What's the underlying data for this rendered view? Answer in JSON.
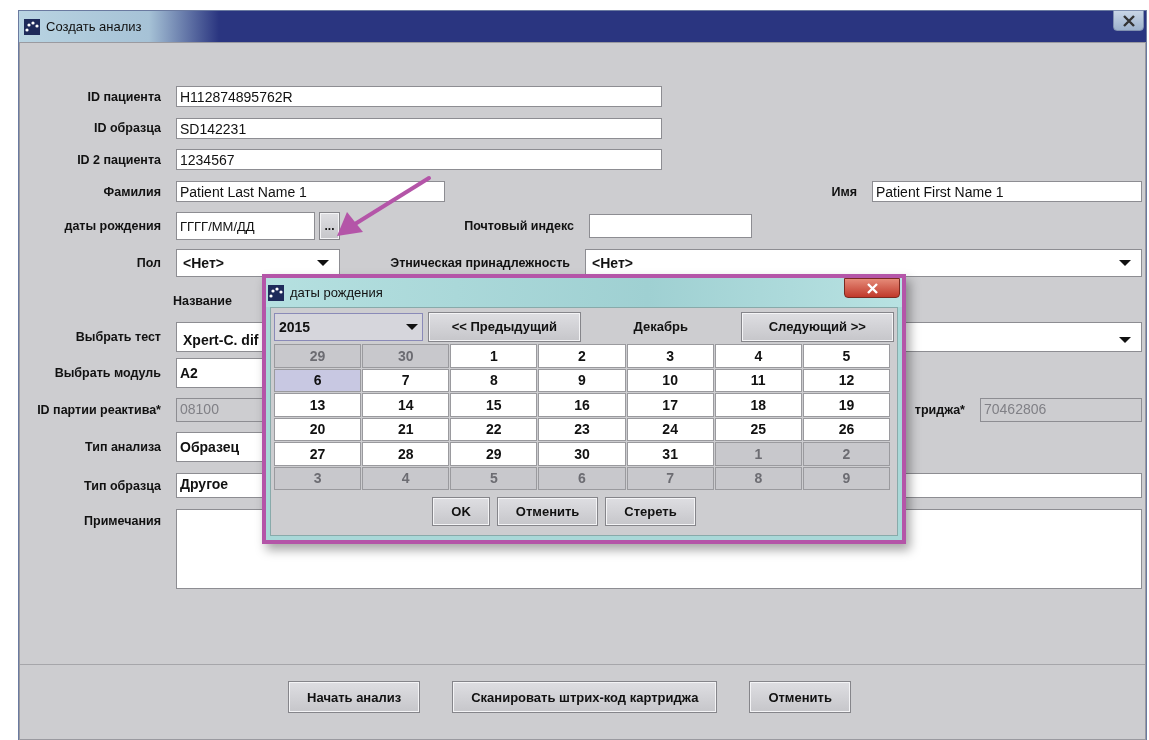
{
  "window": {
    "title": "Создать анализ"
  },
  "form": {
    "rows": [
      {
        "items": [
          {
            "kind": "label",
            "text": "ID пациента"
          },
          {
            "kind": "text",
            "value": "H112874895762R",
            "disabled": false
          }
        ]
      },
      {
        "items": [
          {
            "kind": "label",
            "text": "ID образца"
          },
          {
            "kind": "text",
            "value": "SD142231",
            "disabled": false
          }
        ]
      },
      {
        "items": [
          {
            "kind": "label",
            "text": "ID 2 пациента"
          },
          {
            "kind": "text",
            "value": "1234567",
            "disabled": false
          }
        ]
      },
      {
        "items": [
          {
            "kind": "label",
            "text": "Фамилия"
          },
          {
            "kind": "text",
            "value": "Patient Last Name 1",
            "disabled": false
          },
          {
            "kind": "label",
            "text": "Имя"
          },
          {
            "kind": "text",
            "value": "Patient First Name 1",
            "disabled": false
          }
        ]
      },
      {
        "items": [
          {
            "kind": "label",
            "text": "даты рождения"
          },
          {
            "kind": "text",
            "value": "ГГГГ/ММ/ДД",
            "disabled": false
          },
          {
            "kind": "button",
            "text": "..."
          },
          {
            "kind": "label",
            "text": "Почтовый индекс"
          },
          {
            "kind": "text",
            "disabled": false
          }
        ]
      },
      {
        "items": [
          {
            "kind": "label",
            "text": "Пол"
          },
          {
            "kind": "combo",
            "value": "<Нет>"
          },
          {
            "kind": "label",
            "text": "Этническая принадлежность"
          },
          {
            "kind": "combo",
            "value": "<Нет>"
          }
        ]
      },
      {
        "items": [
          {
            "kind": "caption",
            "text": "Название"
          }
        ]
      },
      {
        "items": [
          {
            "kind": "label",
            "text": "Выбрать тест"
          },
          {
            "kind": "combo",
            "value": "Xpert-C. dif"
          }
        ]
      },
      {
        "items": [
          {
            "kind": "label",
            "text": "Выбрать модуль"
          },
          {
            "kind": "choice",
            "value": "A2"
          }
        ]
      },
      {
        "items": [
          {
            "kind": "label",
            "text": "ID партии реактива*"
          },
          {
            "kind": "text",
            "value": "08100",
            "disabled": true
          },
          {
            "kind": "label",
            "text": "триджа*"
          },
          {
            "kind": "text",
            "value": "70462806",
            "disabled": true
          }
        ]
      },
      {
        "items": [
          {
            "kind": "label",
            "text": "Тип анализа"
          },
          {
            "kind": "choice",
            "value": "Образец"
          }
        ]
      },
      {
        "items": [
          {
            "kind": "label",
            "text": "Тип образца"
          },
          {
            "kind": "choice",
            "value": "Другое"
          }
        ]
      },
      {
        "items": [
          {
            "kind": "label",
            "text": "Примечания"
          },
          {
            "kind": "textarea"
          }
        ]
      }
    ]
  },
  "buttons": [
    "Начать анализ",
    "Сканировать штрих-код картриджа",
    "Отменить"
  ],
  "dialog": {
    "title": "даты рождения",
    "year": "2015",
    "prev": "<< Предыдущий",
    "month": "Декабрь",
    "next": "Следующий >>",
    "days": [
      {
        "text": "29",
        "in_month": false,
        "selected": false
      },
      {
        "text": "30",
        "in_month": false,
        "selected": false
      },
      {
        "text": "1",
        "in_month": true,
        "selected": false
      },
      {
        "text": "2",
        "in_month": true,
        "selected": false
      },
      {
        "text": "3",
        "in_month": true,
        "selected": false
      },
      {
        "text": "4",
        "in_month": true,
        "selected": false
      },
      {
        "text": "5",
        "in_month": true,
        "selected": false
      },
      {
        "text": "6",
        "in_month": true,
        "selected": true
      },
      {
        "text": "7",
        "in_month": true,
        "selected": false
      },
      {
        "text": "8",
        "in_month": true,
        "selected": false
      },
      {
        "text": "9",
        "in_month": true,
        "selected": false
      },
      {
        "text": "10",
        "in_month": true,
        "selected": false
      },
      {
        "text": "11",
        "in_month": true,
        "selected": false
      },
      {
        "text": "12",
        "in_month": true,
        "selected": false
      },
      {
        "text": "13",
        "in_month": true,
        "selected": false
      },
      {
        "text": "14",
        "in_month": true,
        "selected": false
      },
      {
        "text": "15",
        "in_month": true,
        "selected": false
      },
      {
        "text": "16",
        "in_month": true,
        "selected": false
      },
      {
        "text": "17",
        "in_month": true,
        "selected": false
      },
      {
        "text": "18",
        "in_month": true,
        "selected": false
      },
      {
        "text": "19",
        "in_month": true,
        "selected": false
      },
      {
        "text": "20",
        "in_month": true,
        "selected": false
      },
      {
        "text": "21",
        "in_month": true,
        "selected": false
      },
      {
        "text": "22",
        "in_month": true,
        "selected": false
      },
      {
        "text": "23",
        "in_month": true,
        "selected": false
      },
      {
        "text": "24",
        "in_month": true,
        "selected": false
      },
      {
        "text": "25",
        "in_month": true,
        "selected": false
      },
      {
        "text": "26",
        "in_month": true,
        "selected": false
      },
      {
        "text": "27",
        "in_month": true,
        "selected": false
      },
      {
        "text": "28",
        "in_month": true,
        "selected": false
      },
      {
        "text": "29",
        "in_month": true,
        "selected": false
      },
      {
        "text": "30",
        "in_month": true,
        "selected": false
      },
      {
        "text": "31",
        "in_month": true,
        "selected": false
      },
      {
        "text": "1",
        "in_month": false,
        "selected": false
      },
      {
        "text": "2",
        "in_month": false,
        "selected": false
      },
      {
        "text": "3",
        "in_month": false,
        "selected": false
      },
      {
        "text": "4",
        "in_month": false,
        "selected": false
      },
      {
        "text": "5",
        "in_month": false,
        "selected": false
      },
      {
        "text": "6",
        "in_month": false,
        "selected": false
      },
      {
        "text": "7",
        "in_month": false,
        "selected": false
      },
      {
        "text": "8",
        "in_month": false,
        "selected": false
      },
      {
        "text": "9",
        "in_month": false,
        "selected": false
      }
    ],
    "buttons": [
      "OK",
      "Отменить",
      "Стереть"
    ]
  }
}
